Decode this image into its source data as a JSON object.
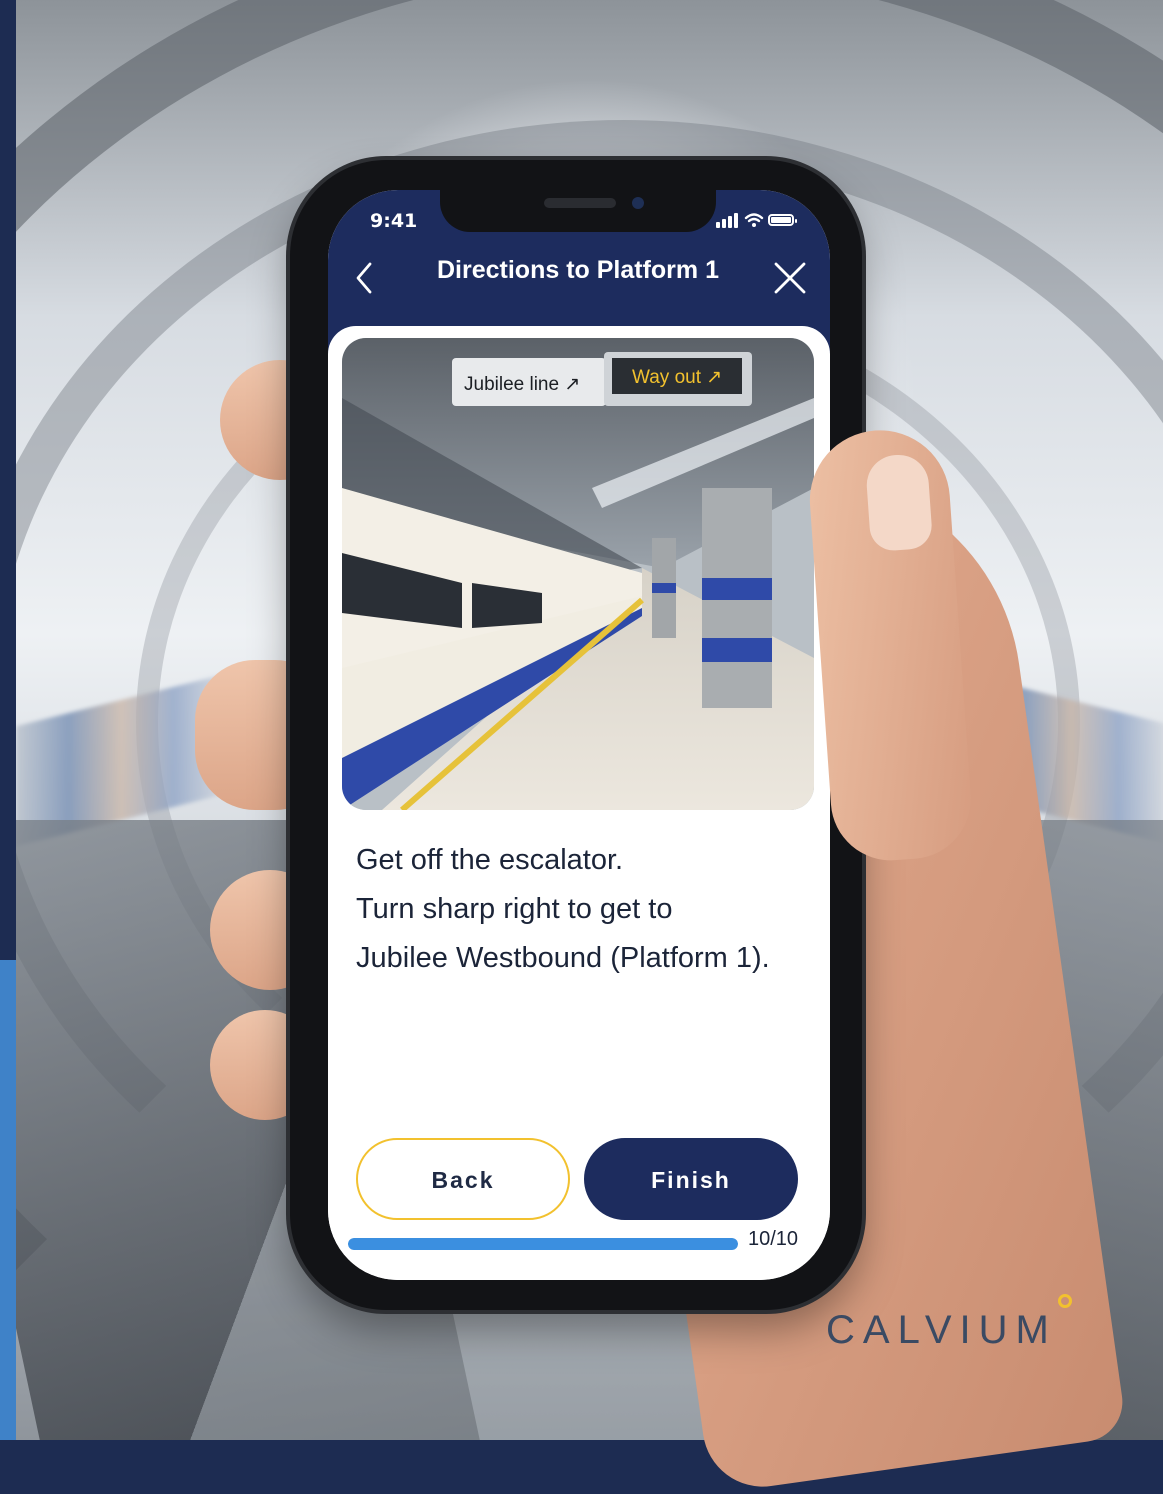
{
  "status_bar": {
    "time": "9:41"
  },
  "nav": {
    "title": "Directions to Platform 1"
  },
  "step_photo": {
    "signs": [
      "Jubilee line ↗",
      "Way out ↗"
    ]
  },
  "instruction": {
    "lines": [
      "Get off the escalator.",
      "Turn sharp right to get to",
      "Jubilee Westbound (Platform 1)."
    ]
  },
  "buttons": {
    "back_label": "Back",
    "finish_label": "Finish"
  },
  "progress": {
    "current": 10,
    "total": 10,
    "label": "10/10"
  },
  "brand": {
    "name": "CALVIUM"
  },
  "colors": {
    "navy": "#1d2c5e",
    "accent_yellow": "#f2c12e",
    "progress_blue": "#3b8fe0",
    "strip_blue": "#3f82c8"
  },
  "icons": {
    "back": "chevron-left-icon",
    "close": "close-icon",
    "signal": "cellular-signal-icon",
    "wifi": "wifi-icon",
    "battery": "battery-icon"
  }
}
